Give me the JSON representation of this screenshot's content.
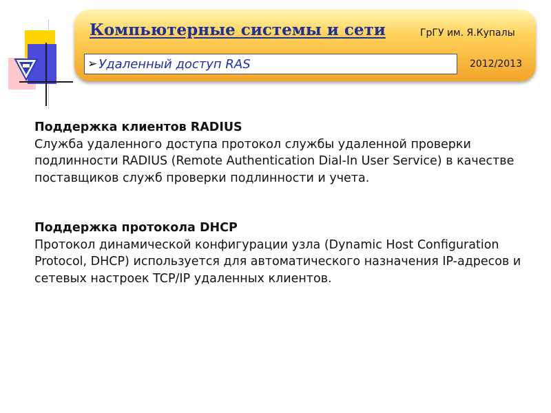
{
  "header": {
    "title": "Компьютерные системы и сети",
    "university": "ГрГУ им. Я.Купалы",
    "subtitle": "Удаленный доступ  RAS",
    "year": "2012/2013",
    "bullet_icon": "arrow-bullet-icon",
    "colors": {
      "title": "#1e2f9a",
      "subtitle": "#1f2fa8",
      "banner": "#ffd25a"
    }
  },
  "sections": [
    {
      "heading": "Поддержка клиентов RADIUS",
      "body": "Служба удаленного доступа протокол службы удаленной проверки подлинности RADIUS (Remote Authentication Dial-In User Service) в качестве поставщиков служб проверки подлинности и учета."
    },
    {
      "heading": "Поддержка протокола DHCP",
      "body": "Протокол динамической конфигурации узла (Dynamic Host Configuration Protocol, DHCP) используется для автоматического назначения IP-адресов и сетевых настроек TCP/IP удаленных клиентов."
    }
  ]
}
